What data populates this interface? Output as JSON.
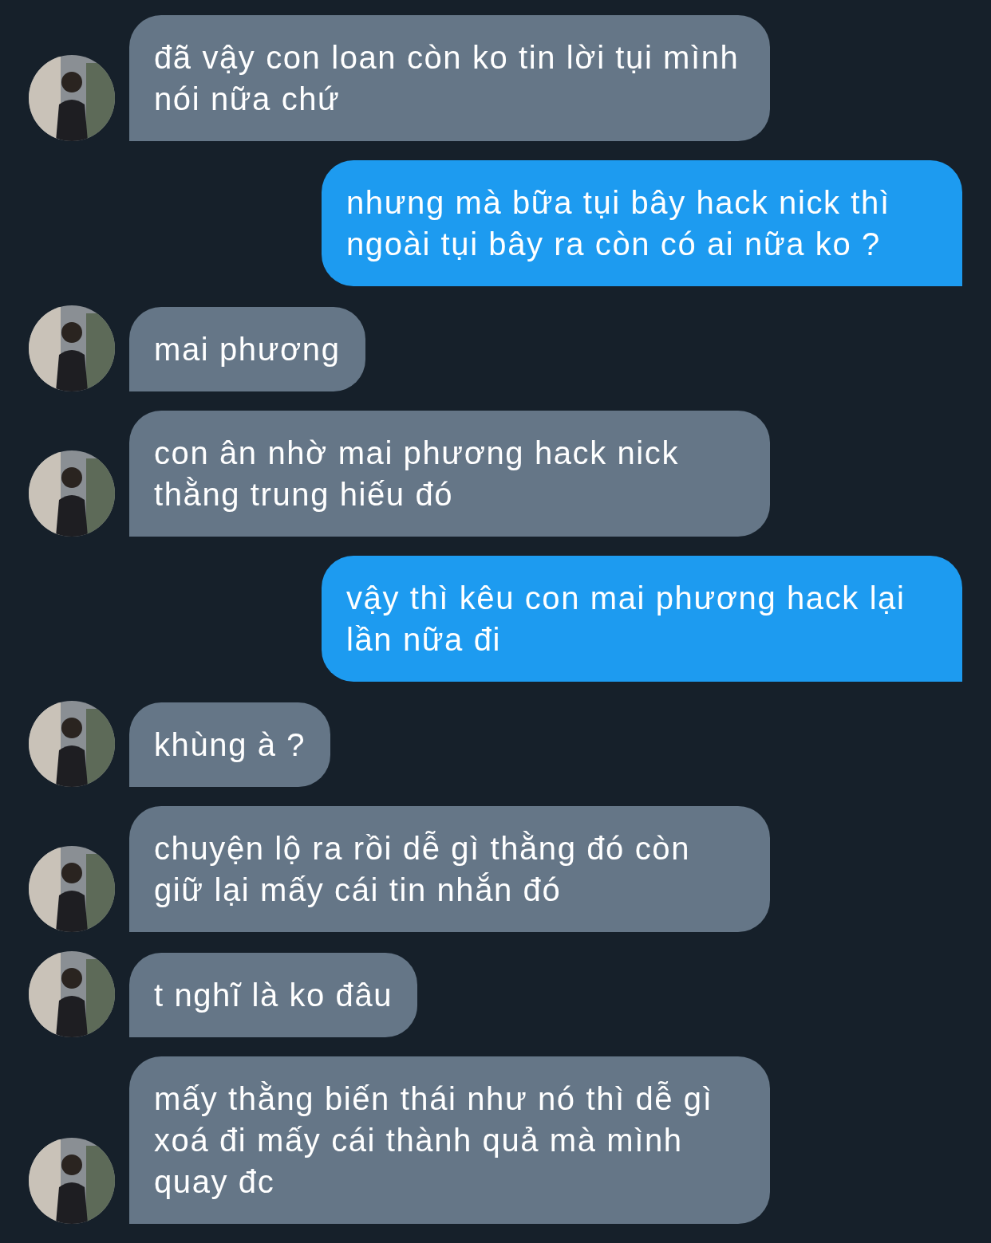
{
  "messages": [
    {
      "kind": "incoming",
      "text": "đã vậy con loan còn ko tin lời tụi mình nói nữa chứ"
    },
    {
      "kind": "outgoing",
      "text": "nhưng mà bữa tụi bây hack nick thì ngoài tụi bây ra còn có ai nữa ko ?"
    },
    {
      "kind": "incoming",
      "text": "mai phương"
    },
    {
      "kind": "incoming",
      "text": "con ân nhờ mai phương hack nick thằng trung hiếu đó"
    },
    {
      "kind": "outgoing",
      "text": "vậy thì kêu con mai phương hack lại lần nữa đi"
    },
    {
      "kind": "incoming",
      "text": "khùng à ?"
    },
    {
      "kind": "incoming",
      "text": "chuyện lộ ra rồi dễ gì thằng đó còn giữ lại mấy cái tin nhắn đó"
    },
    {
      "kind": "incoming",
      "text": "t nghĩ là ko đâu"
    },
    {
      "kind": "incoming",
      "text": "mấy thằng biến thái như nó thì dễ gì xoá đi mấy cái thành quả mà mình quay đc"
    }
  ]
}
